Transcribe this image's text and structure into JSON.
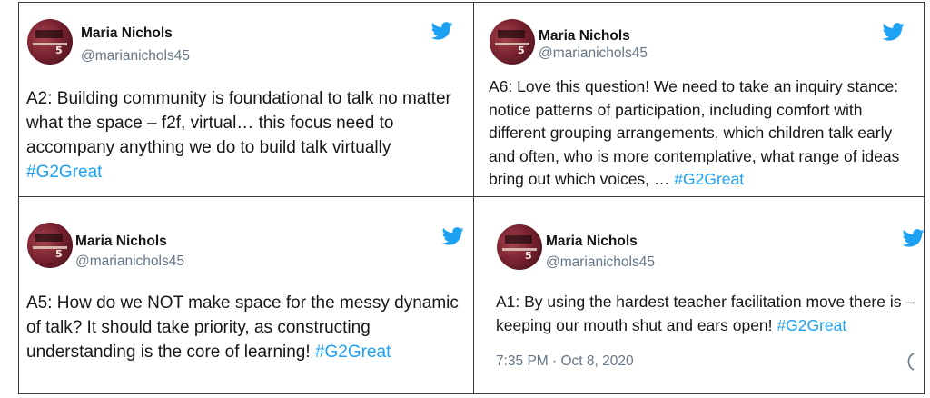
{
  "tweets": [
    {
      "name": "Maria Nichols",
      "handle": "@marianichols45",
      "text": "A2:  Building community is foundational to talk no matter what the space – f2f, virtual…  this focus need to accompany anything we do to build talk virtually ",
      "hashtag": "#G2Great"
    },
    {
      "name": "Maria Nichols",
      "handle": "@marianichols45",
      "text": "A6:  Love this question! We need to take an inquiry stance: notice patterns of participation, including comfort with different grouping arrangements, which children talk early and often, who is more contemplative, what range of ideas bring out which voices, …   ",
      "hashtag": "#G2Great"
    },
    {
      "name": "Maria Nichols",
      "handle": "@marianichols45",
      "text": "A5:  How do we NOT make space for the messy dynamic of talk? It should take priority, as constructing understanding is the core of learning!  ",
      "hashtag": "#G2Great"
    },
    {
      "name": "Maria Nichols",
      "handle": "@marianichols45",
      "text": "A1:  By using the hardest teacher facilitation move there is – keeping our mouth shut and ears open!  ",
      "hashtag": "#G2Great",
      "timestamp": "7:35 PM · Oct 8, 2020"
    }
  ],
  "icons": {
    "brand": "twitter-bird-icon",
    "info": "info-icon"
  },
  "colors": {
    "hashtag": "#1da1f2",
    "handle": "#657786",
    "border": "#3a3a3a"
  }
}
